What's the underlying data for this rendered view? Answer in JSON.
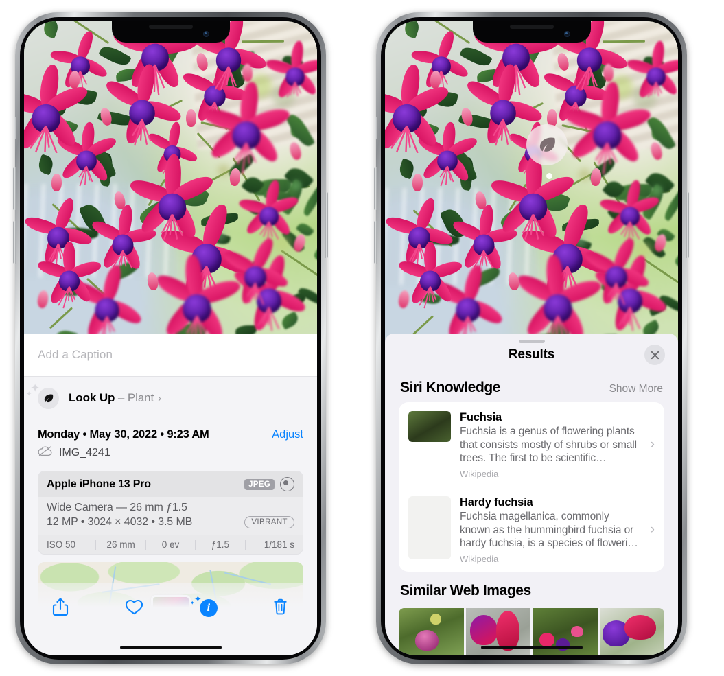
{
  "left_phone": {
    "caption_field": {
      "placeholder": "Add a Caption",
      "value": ""
    },
    "look_up": {
      "label": "Look Up",
      "separator": "–",
      "subject": "Plant",
      "chevron": "›",
      "icon": "leaf-icon",
      "sparkle": "✦"
    },
    "date_row": {
      "date": "Monday • May 30, 2022 • 9:23 AM",
      "adjust_label": "Adjust"
    },
    "file_row": {
      "filename": "IMG_4241",
      "icon": "icloud-slash-icon"
    },
    "metadata_card": {
      "model": "Apple iPhone 13 Pro",
      "format_badge": "JPEG",
      "aperture_icon": "aperture-icon",
      "lens_line": "Wide Camera — 26 mm ƒ1.5",
      "size_line": "12 MP • 3024 × 4032 • 3.5 MB",
      "style_badge": "VIBRANT",
      "exif": [
        "ISO 50",
        "26 mm",
        "0 ev",
        "ƒ1.5",
        "1/181 s"
      ]
    },
    "map": {
      "pin_label": "photo-location-pin"
    },
    "toolbar": {
      "share_label": "share-button",
      "favorite_label": "favorite-button",
      "info_label": "info-button",
      "info_glyph": "i",
      "delete_label": "delete-button"
    }
  },
  "right_phone": {
    "visual_lookup_badge": {
      "icon": "leaf-icon"
    },
    "results_sheet": {
      "title": "Results",
      "close_label": "✕",
      "sections": [
        {
          "title": "Siri Knowledge",
          "action": "Show More",
          "items": [
            {
              "title": "Fuchsia",
              "description": "Fuchsia is a genus of flowering plants that consists mostly of shrubs or small trees. The first to be scientific…",
              "source": "Wikipedia",
              "chevron": "›"
            },
            {
              "title": "Hardy fuchsia",
              "description": "Fuchsia magellanica, commonly known as the hummingbird fuchsia or hardy fuchsia, is a species of floweri…",
              "source": "Wikipedia",
              "chevron": "›"
            }
          ]
        },
        {
          "title": "Similar Web Images",
          "items": [
            "web-image-1",
            "web-image-2",
            "web-image-3",
            "web-image-4"
          ]
        }
      ]
    }
  },
  "colors": {
    "accent_blue": "#0a84ff",
    "sheet_background": "#f2f1f6",
    "card_background": "#ffffff",
    "secondary_text": "#8a8a8e"
  }
}
